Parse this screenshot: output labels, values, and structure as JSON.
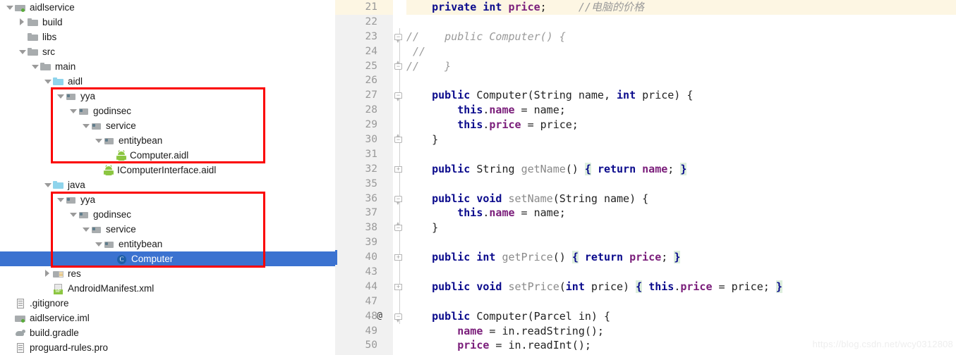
{
  "project_tree": {
    "items": [
      {
        "label": "aidlservice",
        "icon": "module-folder-icon",
        "arrow": "down",
        "indent": 0
      },
      {
        "label": "build",
        "icon": "folder-icon",
        "arrow": "right",
        "indent": 1
      },
      {
        "label": "libs",
        "icon": "folder-icon",
        "arrow": "none",
        "indent": 1
      },
      {
        "label": "src",
        "icon": "folder-icon",
        "arrow": "down",
        "indent": 1
      },
      {
        "label": "main",
        "icon": "folder-icon",
        "arrow": "down",
        "indent": 2
      },
      {
        "label": "aidl",
        "icon": "source-folder-icon",
        "arrow": "down",
        "indent": 3
      },
      {
        "label": "yya",
        "icon": "package-icon",
        "arrow": "down",
        "indent": 4
      },
      {
        "label": "godinsec",
        "icon": "package-icon",
        "arrow": "down",
        "indent": 5
      },
      {
        "label": "service",
        "icon": "package-icon",
        "arrow": "down",
        "indent": 6
      },
      {
        "label": "entitybean",
        "icon": "package-icon",
        "arrow": "down",
        "indent": 7
      },
      {
        "label": "Computer.aidl",
        "icon": "android-file-icon",
        "arrow": "none",
        "indent": 8
      },
      {
        "label": "IComputerInterface.aidl",
        "icon": "android-file-icon",
        "arrow": "none",
        "indent": 7
      },
      {
        "label": "java",
        "icon": "source-folder-icon",
        "arrow": "down",
        "indent": 3
      },
      {
        "label": "yya",
        "icon": "package-icon",
        "arrow": "down",
        "indent": 4
      },
      {
        "label": "godinsec",
        "icon": "package-icon",
        "arrow": "down",
        "indent": 5
      },
      {
        "label": "service",
        "icon": "package-icon",
        "arrow": "down",
        "indent": 6
      },
      {
        "label": "entitybean",
        "icon": "package-icon",
        "arrow": "down",
        "indent": 7
      },
      {
        "label": "Computer",
        "icon": "java-class-icon",
        "arrow": "none",
        "indent": 8,
        "selected": true
      },
      {
        "label": "res",
        "icon": "res-folder-icon",
        "arrow": "right",
        "indent": 3
      },
      {
        "label": "AndroidManifest.xml",
        "icon": "manifest-file-icon",
        "arrow": "none",
        "indent": 3
      },
      {
        "label": ".gitignore",
        "icon": "text-file-icon",
        "arrow": "none",
        "indent": 0
      },
      {
        "label": "aidlservice.iml",
        "icon": "module-folder-icon",
        "arrow": "none",
        "indent": 0
      },
      {
        "label": "build.gradle",
        "icon": "gradle-file-icon",
        "arrow": "none",
        "indent": 0
      },
      {
        "label": "proguard-rules.pro",
        "icon": "text-file-icon",
        "arrow": "none",
        "indent": 0
      }
    ],
    "annotation_boxes": [
      {
        "name": "aidl-package-highlight",
        "color": "#fb0000"
      },
      {
        "name": "java-package-highlight",
        "color": "#fb0000"
      }
    ],
    "selection_color": "#3B72D0"
  },
  "editor": {
    "highlight_line_color": "#fdf6e3",
    "change_marker_color": "#3b72d0",
    "lines": [
      {
        "num": "21",
        "ann": "",
        "fold": "",
        "highlighted": true,
        "tokens": [
          {
            "t": "    ",
            "c": "plain"
          },
          {
            "t": "private",
            "c": "kw"
          },
          {
            "t": " ",
            "c": "plain"
          },
          {
            "t": "int",
            "c": "kw"
          },
          {
            "t": " ",
            "c": "plain"
          },
          {
            "t": "price",
            "c": "fld"
          },
          {
            "t": ";",
            "c": "plain"
          },
          {
            "t": "     ",
            "c": "plain"
          },
          {
            "t": "//电脑的价格",
            "c": "cm"
          }
        ]
      },
      {
        "num": "22",
        "ann": "",
        "fold": "",
        "tokens": []
      },
      {
        "num": "23",
        "ann": "",
        "fold": "start-minus",
        "tokens": [
          {
            "t": "//    public Computer() {",
            "c": "cm"
          }
        ]
      },
      {
        "num": "24",
        "ann": "",
        "fold": "",
        "tokens": [
          {
            "t": " //",
            "c": "cm"
          }
        ]
      },
      {
        "num": "25",
        "ann": "",
        "fold": "end-minus",
        "tokens": [
          {
            "t": "//    }",
            "c": "cm"
          }
        ]
      },
      {
        "num": "26",
        "ann": "",
        "fold": "",
        "tokens": []
      },
      {
        "num": "27",
        "ann": "",
        "fold": "start-minus",
        "tokens": [
          {
            "t": "    ",
            "c": "plain"
          },
          {
            "t": "public",
            "c": "kw"
          },
          {
            "t": " Computer(String name, ",
            "c": "plain"
          },
          {
            "t": "int",
            "c": "kw"
          },
          {
            "t": " price) {",
            "c": "plain"
          }
        ]
      },
      {
        "num": "28",
        "ann": "",
        "fold": "",
        "tokens": [
          {
            "t": "        ",
            "c": "plain"
          },
          {
            "t": "this",
            "c": "kw"
          },
          {
            "t": ".",
            "c": "plain"
          },
          {
            "t": "name",
            "c": "fld"
          },
          {
            "t": " = name;",
            "c": "plain"
          }
        ]
      },
      {
        "num": "29",
        "ann": "",
        "fold": "",
        "tokens": [
          {
            "t": "        ",
            "c": "plain"
          },
          {
            "t": "this",
            "c": "kw"
          },
          {
            "t": ".",
            "c": "plain"
          },
          {
            "t": "price",
            "c": "fld"
          },
          {
            "t": " = price;",
            "c": "plain"
          }
        ]
      },
      {
        "num": "30",
        "ann": "",
        "fold": "end-minus",
        "tokens": [
          {
            "t": "    }",
            "c": "plain"
          }
        ]
      },
      {
        "num": "31",
        "ann": "",
        "fold": "",
        "tokens": []
      },
      {
        "num": "32",
        "ann": "",
        "fold": "plus",
        "tokens": [
          {
            "t": "    ",
            "c": "plain"
          },
          {
            "t": "public",
            "c": "kw"
          },
          {
            "t": " String ",
            "c": "plain"
          },
          {
            "t": "getName",
            "c": "mth"
          },
          {
            "t": "() ",
            "c": "plain"
          },
          {
            "t": "{",
            "c": "brace"
          },
          {
            "t": " ",
            "c": "plain"
          },
          {
            "t": "return",
            "c": "kw"
          },
          {
            "t": " ",
            "c": "plain"
          },
          {
            "t": "name",
            "c": "fld"
          },
          {
            "t": "; ",
            "c": "plain"
          },
          {
            "t": "}",
            "c": "brace"
          }
        ]
      },
      {
        "num": "35",
        "ann": "",
        "fold": "",
        "tokens": []
      },
      {
        "num": "36",
        "ann": "",
        "fold": "start-minus",
        "tokens": [
          {
            "t": "    ",
            "c": "plain"
          },
          {
            "t": "public",
            "c": "kw"
          },
          {
            "t": " ",
            "c": "plain"
          },
          {
            "t": "void",
            "c": "kw"
          },
          {
            "t": " ",
            "c": "plain"
          },
          {
            "t": "setName",
            "c": "mth"
          },
          {
            "t": "(String name) {",
            "c": "plain"
          }
        ]
      },
      {
        "num": "37",
        "ann": "",
        "fold": "",
        "tokens": [
          {
            "t": "        ",
            "c": "plain"
          },
          {
            "t": "this",
            "c": "kw"
          },
          {
            "t": ".",
            "c": "plain"
          },
          {
            "t": "name",
            "c": "fld"
          },
          {
            "t": " = name;",
            "c": "plain"
          }
        ]
      },
      {
        "num": "38",
        "ann": "",
        "fold": "end-minus",
        "tokens": [
          {
            "t": "    }",
            "c": "plain"
          }
        ]
      },
      {
        "num": "39",
        "ann": "",
        "fold": "",
        "tokens": []
      },
      {
        "num": "40",
        "ann": "",
        "fold": "plus",
        "change": true,
        "tokens": [
          {
            "t": "    ",
            "c": "plain"
          },
          {
            "t": "public",
            "c": "kw"
          },
          {
            "t": " ",
            "c": "plain"
          },
          {
            "t": "int",
            "c": "kw"
          },
          {
            "t": " ",
            "c": "plain"
          },
          {
            "t": "getPrice",
            "c": "mth"
          },
          {
            "t": "() ",
            "c": "plain"
          },
          {
            "t": "{",
            "c": "brace"
          },
          {
            "t": " ",
            "c": "plain"
          },
          {
            "t": "return",
            "c": "kw"
          },
          {
            "t": " ",
            "c": "plain"
          },
          {
            "t": "price",
            "c": "fld"
          },
          {
            "t": "; ",
            "c": "plain"
          },
          {
            "t": "}",
            "c": "brace"
          }
        ]
      },
      {
        "num": "43",
        "ann": "",
        "fold": "",
        "tokens": []
      },
      {
        "num": "44",
        "ann": "",
        "fold": "plus",
        "tokens": [
          {
            "t": "    ",
            "c": "plain"
          },
          {
            "t": "public",
            "c": "kw"
          },
          {
            "t": " ",
            "c": "plain"
          },
          {
            "t": "void",
            "c": "kw"
          },
          {
            "t": " ",
            "c": "plain"
          },
          {
            "t": "setPrice",
            "c": "mth"
          },
          {
            "t": "(",
            "c": "plain"
          },
          {
            "t": "int",
            "c": "kw"
          },
          {
            "t": " price) ",
            "c": "plain"
          },
          {
            "t": "{",
            "c": "brace"
          },
          {
            "t": " ",
            "c": "plain"
          },
          {
            "t": "this",
            "c": "kw"
          },
          {
            "t": ".",
            "c": "plain"
          },
          {
            "t": "price",
            "c": "fld"
          },
          {
            "t": " = price; ",
            "c": "plain"
          },
          {
            "t": "}",
            "c": "brace"
          }
        ]
      },
      {
        "num": "47",
        "ann": "",
        "fold": "",
        "tokens": []
      },
      {
        "num": "48",
        "ann": "@",
        "fold": "start-minus",
        "tokens": [
          {
            "t": "    ",
            "c": "plain"
          },
          {
            "t": "public",
            "c": "kw"
          },
          {
            "t": " Computer(Parcel in) {",
            "c": "plain"
          }
        ]
      },
      {
        "num": "49",
        "ann": "",
        "fold": "",
        "tokens": [
          {
            "t": "        ",
            "c": "plain"
          },
          {
            "t": "name",
            "c": "fld"
          },
          {
            "t": " = in.readString();",
            "c": "plain"
          }
        ]
      },
      {
        "num": "50",
        "ann": "",
        "fold": "",
        "tokens": [
          {
            "t": "        ",
            "c": "plain"
          },
          {
            "t": "price",
            "c": "fld"
          },
          {
            "t": " = in.readInt();",
            "c": "plain"
          }
        ]
      }
    ]
  },
  "watermark": {
    "text": "https://blog.csdn.net/wcy0312808"
  }
}
